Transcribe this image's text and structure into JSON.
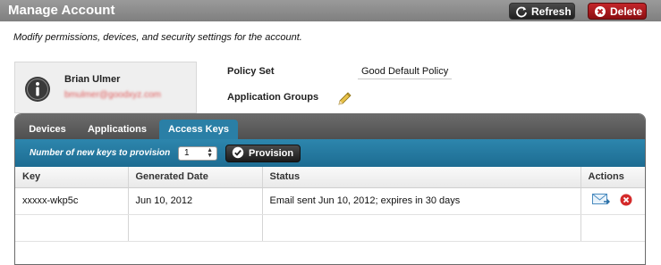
{
  "header": {
    "title": "Manage Account",
    "refresh_label": "Refresh",
    "delete_label": "Delete"
  },
  "description": "Modify permissions, devices, and security settings for the account.",
  "user": {
    "name": "Brian Ulmer",
    "email": "bmulmer@goodxyz.com"
  },
  "policy": {
    "policy_set_label": "Policy Set",
    "policy_set_value": "Good Default Policy",
    "application_groups_label": "Application Groups"
  },
  "tabs": [
    {
      "label": "Devices",
      "active": false
    },
    {
      "label": "Applications",
      "active": false
    },
    {
      "label": "Access Keys",
      "active": true
    }
  ],
  "provision": {
    "label": "Number of new keys to provision",
    "selected_value": "1",
    "button_label": "Provision"
  },
  "table": {
    "columns": [
      "Key",
      "Generated Date",
      "Status",
      "Actions"
    ],
    "rows": [
      {
        "key": "xxxxx-wkp5c",
        "generated_date": "Jun 10, 2012",
        "status": "Email sent Jun 10, 2012; expires in 30 days",
        "actions": [
          "email-icon",
          "delete-x-icon"
        ]
      }
    ]
  },
  "colors": {
    "header_bg": "#8a8a8a",
    "tab_active": "#2a7fa6",
    "delete_red": "#b01a1e",
    "link_email_redacted": "#e05a5a"
  }
}
